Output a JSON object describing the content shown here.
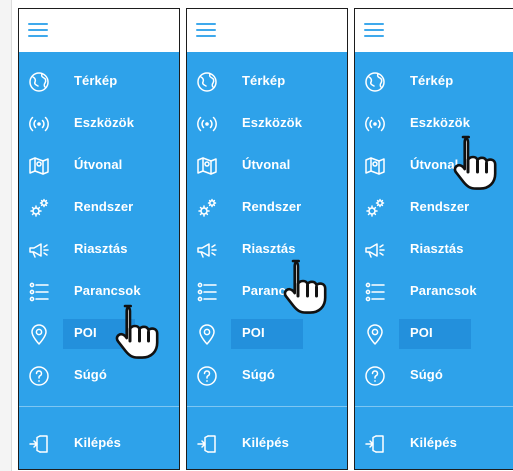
{
  "panels": [
    {
      "menu": [
        {
          "label": "Térkép",
          "icon": "globe-icon"
        },
        {
          "label": "Eszközök",
          "icon": "signal-icon"
        },
        {
          "label": "Útvonal",
          "icon": "map-route-icon"
        },
        {
          "label": "Rendszer",
          "icon": "gears-icon"
        },
        {
          "label": "Riasztás",
          "icon": "megaphone-icon"
        },
        {
          "label": "Parancsok",
          "icon": "list-icon"
        },
        {
          "label": "POI",
          "icon": "location-pin-icon",
          "active": true
        },
        {
          "label": "Súgó",
          "icon": "help-icon"
        }
      ],
      "logout": {
        "label": "Kilépés",
        "icon": "exit-door-icon"
      },
      "pointer_over": "Parancsok"
    },
    {
      "menu": [
        {
          "label": "Térkép",
          "icon": "globe-icon"
        },
        {
          "label": "Eszközök",
          "icon": "signal-icon"
        },
        {
          "label": "Útvonal",
          "icon": "map-route-icon"
        },
        {
          "label": "Rendszer",
          "icon": "gears-icon"
        },
        {
          "label": "Riasztás",
          "icon": "megaphone-icon"
        },
        {
          "label": "Parancsok",
          "icon": "list-icon"
        },
        {
          "label": "POI",
          "icon": "location-pin-icon",
          "active": true
        },
        {
          "label": "Súgó",
          "icon": "help-icon"
        }
      ],
      "logout": {
        "label": "Kilépés",
        "icon": "exit-door-icon"
      },
      "pointer_over": "Riasztás"
    },
    {
      "menu": [
        {
          "label": "Térkép",
          "icon": "globe-icon"
        },
        {
          "label": "Eszközök",
          "icon": "signal-icon"
        },
        {
          "label": "Útvonal",
          "icon": "map-route-icon"
        },
        {
          "label": "Rendszer",
          "icon": "gears-icon"
        },
        {
          "label": "Riasztás",
          "icon": "megaphone-icon"
        },
        {
          "label": "Parancsok",
          "icon": "list-icon"
        },
        {
          "label": "POI",
          "icon": "location-pin-icon",
          "active": true
        },
        {
          "label": "Súgó",
          "icon": "help-icon"
        }
      ],
      "logout": {
        "label": "Kilépés",
        "icon": "exit-door-icon"
      },
      "pointer_over": "Eszközök"
    }
  ],
  "colors": {
    "sidebar": "#2ea2ea",
    "active_highlight": "#2390dc",
    "top_bar": "#ffffff",
    "text": "#ffffff",
    "hamburger": "#3fa9ec",
    "panel_border": "#1d1d1d"
  },
  "topbar_icon": "hamburger-menu-icon",
  "cursor_icon": "hand-pointer-icon"
}
